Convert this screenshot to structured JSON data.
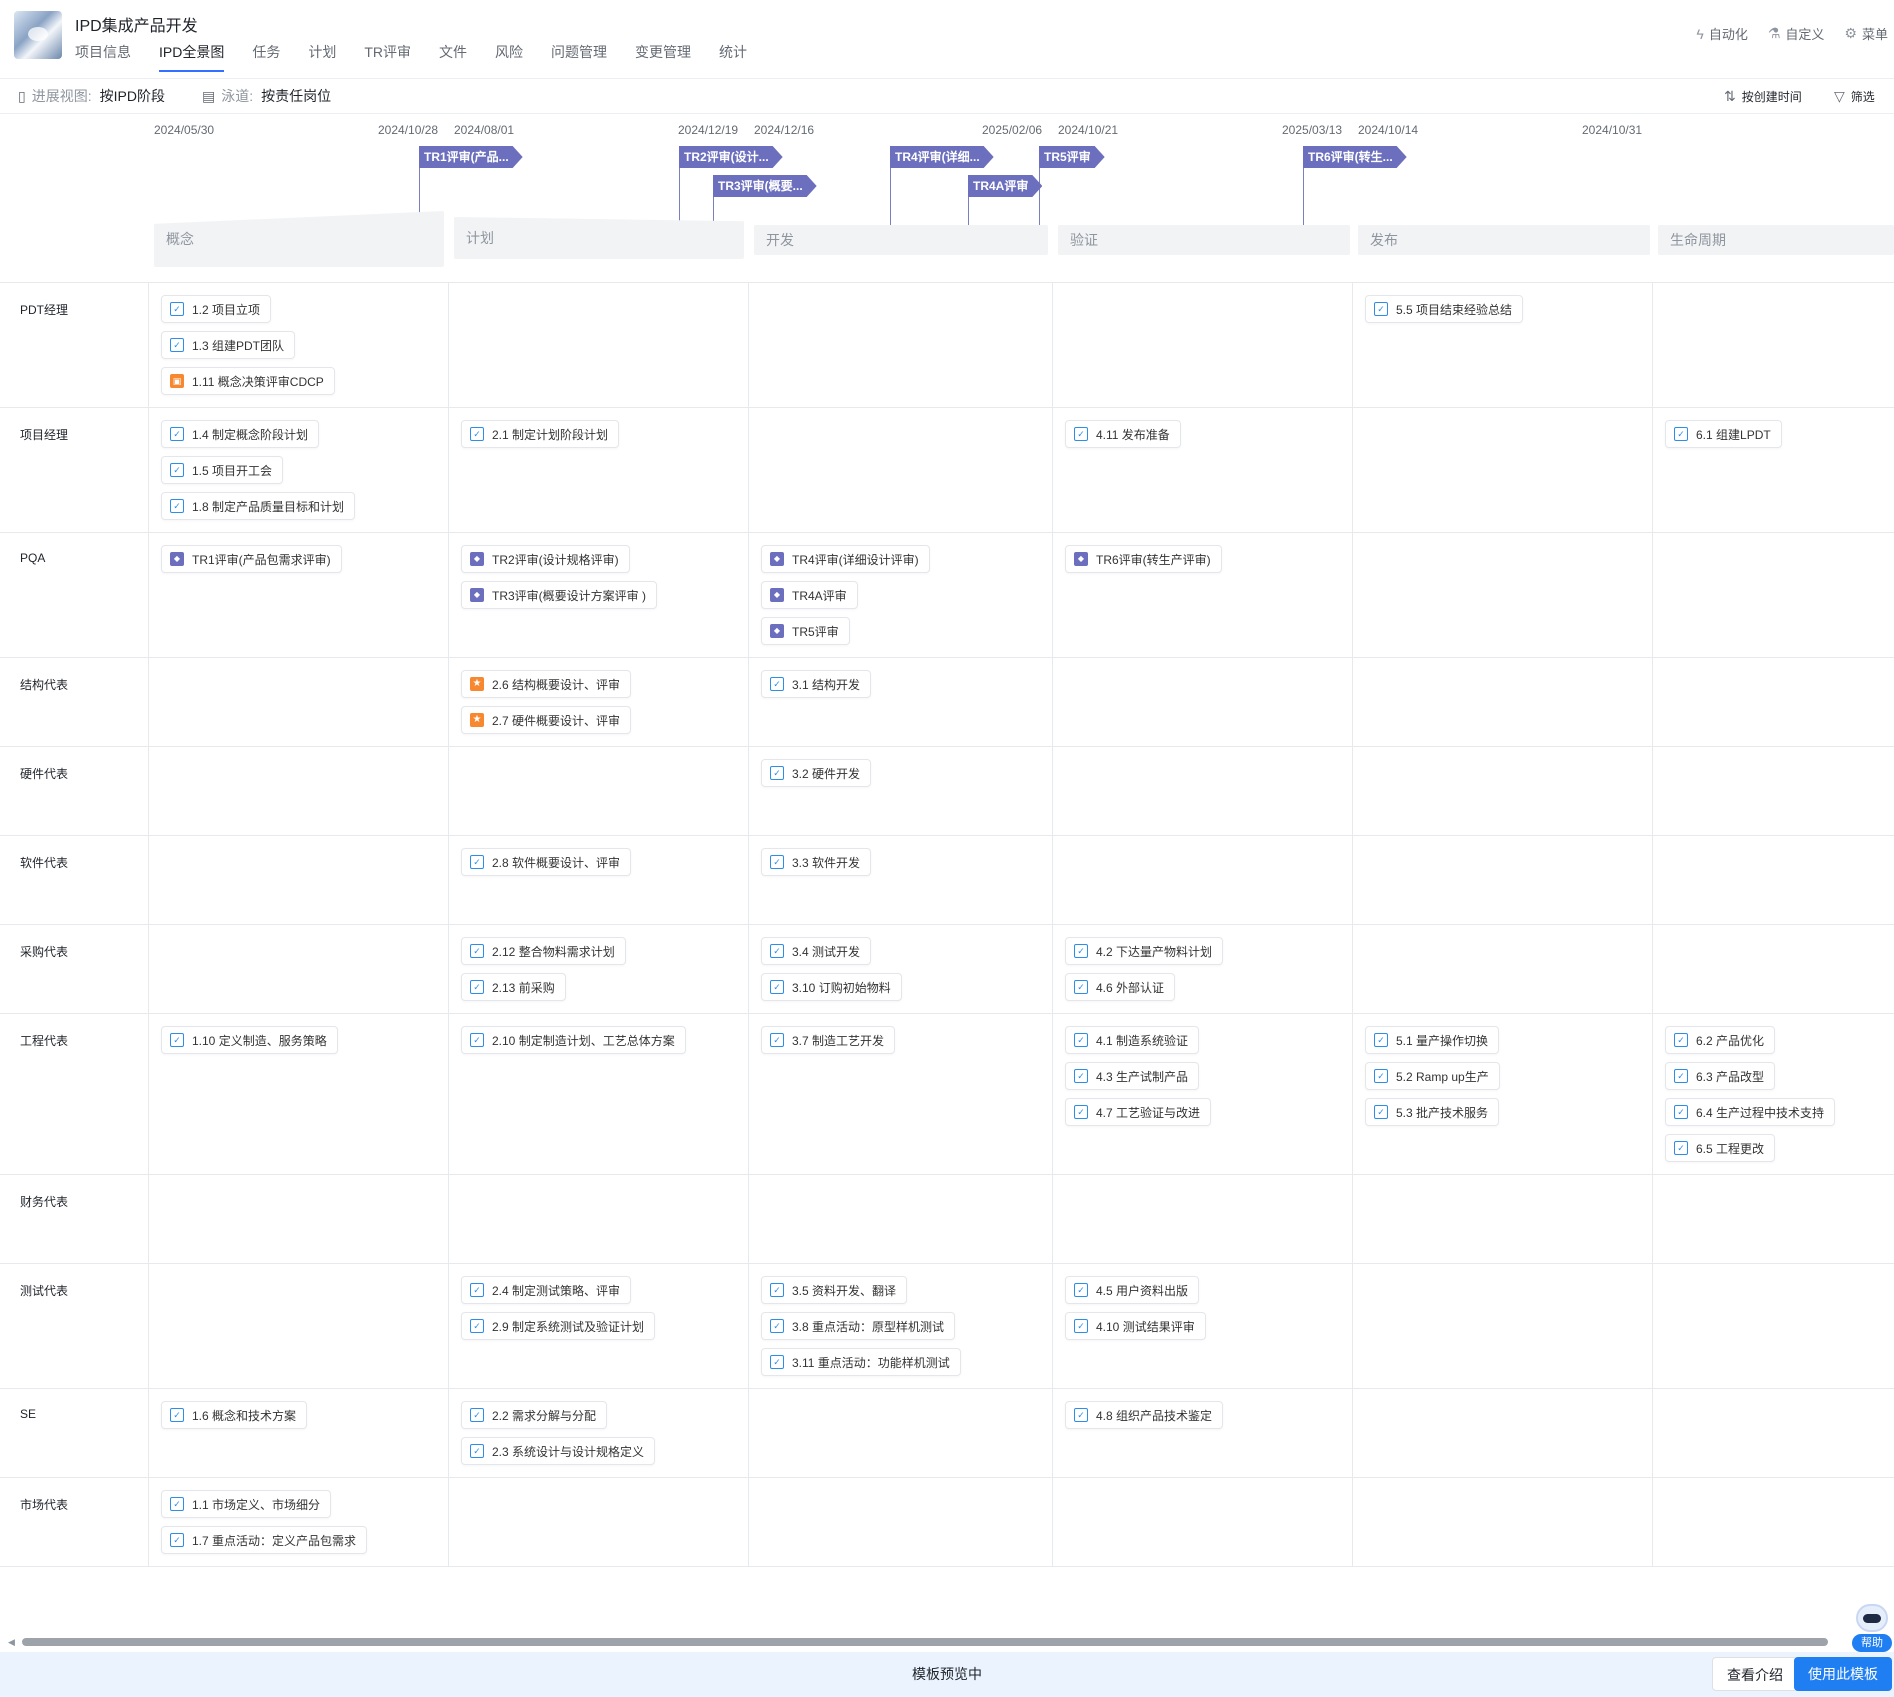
{
  "app": {
    "title": "IPD集成产品开发",
    "logo": "project-thumbnail"
  },
  "nav": {
    "tabs": [
      "项目信息",
      "IPD全景图",
      "任务",
      "计划",
      "TR评审",
      "文件",
      "风险",
      "问题管理",
      "变更管理",
      "统计"
    ],
    "active_index": 1
  },
  "header_actions": [
    {
      "label": "自动化",
      "icon": "lightning-icon"
    },
    {
      "label": "自定义",
      "icon": "flask-icon"
    },
    {
      "label": "菜单",
      "icon": "settings-sliders-icon"
    }
  ],
  "toolbar": {
    "view_label": "进展视图:",
    "view_value": "按IPD阶段",
    "lane_label": "泳道:",
    "lane_value": "按责任岗位",
    "sort_label": "按创建时间",
    "filter_label": "筛选"
  },
  "timeline": {
    "dates": [
      "2024/05/30",
      "2024/10/28",
      "2024/08/01",
      "2024/12/19",
      "2024/12/16",
      "2025/02/06",
      "2024/10/21",
      "2025/03/13",
      "2024/10/14",
      "2024/10/31"
    ],
    "milestones": [
      "TR1评审(产品...",
      "TR2评审(设计...",
      "TR3评审(概要...",
      "TR4评审(详细...",
      "TR4A评审",
      "TR5评审",
      "TR6评审(转生..."
    ],
    "phases": [
      "概念",
      "计划",
      "开发",
      "验证",
      "发布",
      "生命周期"
    ]
  },
  "lanes": [
    {
      "name": "PDT经理",
      "cells": [
        [
          {
            "t": "task",
            "label": "1.2 项目立项"
          },
          {
            "t": "task",
            "label": "1.3 组建PDT团队"
          },
          {
            "t": "decision",
            "label": "1.11 概念决策评审CDCP"
          }
        ],
        [],
        [],
        [],
        [
          {
            "t": "task",
            "label": "5.5 项目结束经验总结"
          }
        ],
        []
      ]
    },
    {
      "name": "项目经理",
      "cells": [
        [
          {
            "t": "task",
            "label": "1.4 制定概念阶段计划"
          },
          {
            "t": "task",
            "label": "1.5 项目开工会"
          },
          {
            "t": "task",
            "label": "1.8 制定产品质量目标和计划"
          }
        ],
        [
          {
            "t": "task",
            "label": "2.1 制定计划阶段计划"
          }
        ],
        [],
        [
          {
            "t": "task",
            "label": "4.11 发布准备"
          }
        ],
        [],
        [
          {
            "t": "task",
            "label": "6.1 组建LPDT"
          }
        ]
      ]
    },
    {
      "name": "PQA",
      "cells": [
        [
          {
            "t": "review",
            "label": "TR1评审(产品包需求评审)"
          }
        ],
        [
          {
            "t": "review",
            "label": "TR2评审(设计规格评审)"
          },
          {
            "t": "review",
            "label": "TR3评审(概要设计方案评审 )"
          }
        ],
        [
          {
            "t": "review",
            "label": "TR4评审(详细设计评审)"
          },
          {
            "t": "review",
            "label": "TR4A评审"
          },
          {
            "t": "review",
            "label": "TR5评审"
          }
        ],
        [
          {
            "t": "review",
            "label": "TR6评审(转生产评审)"
          }
        ],
        [],
        []
      ]
    },
    {
      "name": "结构代表",
      "cells": [
        [],
        [
          {
            "t": "milestone",
            "label": "2.6 结构概要设计、评审"
          },
          {
            "t": "milestone",
            "label": "2.7 硬件概要设计、评审"
          }
        ],
        [
          {
            "t": "task",
            "label": "3.1 结构开发"
          }
        ],
        [],
        [],
        []
      ]
    },
    {
      "name": "硬件代表",
      "cells": [
        [],
        [],
        [
          {
            "t": "task",
            "label": "3.2 硬件开发"
          }
        ],
        [],
        [],
        []
      ]
    },
    {
      "name": "软件代表",
      "cells": [
        [],
        [
          {
            "t": "task",
            "label": "2.8 软件概要设计、评审"
          }
        ],
        [
          {
            "t": "task",
            "label": "3.3 软件开发"
          }
        ],
        [],
        [],
        []
      ]
    },
    {
      "name": "采购代表",
      "cells": [
        [],
        [
          {
            "t": "task",
            "label": "2.12 整合物料需求计划"
          },
          {
            "t": "task",
            "label": "2.13 前采购"
          }
        ],
        [
          {
            "t": "task",
            "label": "3.4 测试开发"
          },
          {
            "t": "task",
            "label": "3.10 订购初始物料"
          }
        ],
        [
          {
            "t": "task",
            "label": "4.2 下达量产物料计划"
          },
          {
            "t": "task",
            "label": "4.6 外部认证"
          }
        ],
        [],
        []
      ]
    },
    {
      "name": "工程代表",
      "cells": [
        [
          {
            "t": "task",
            "label": "1.10 定义制造、服务策略"
          }
        ],
        [
          {
            "t": "task",
            "label": "2.10 制定制造计划、工艺总体方案"
          }
        ],
        [
          {
            "t": "task",
            "label": "3.7 制造工艺开发"
          }
        ],
        [
          {
            "t": "task",
            "label": "4.1 制造系统验证"
          },
          {
            "t": "task",
            "label": "4.3 生产试制产品"
          },
          {
            "t": "task",
            "label": "4.7 工艺验证与改进"
          }
        ],
        [
          {
            "t": "task",
            "label": "5.1 量产操作切换"
          },
          {
            "t": "task",
            "label": "5.2 Ramp up生产"
          },
          {
            "t": "task",
            "label": "5.3 批产技术服务"
          }
        ],
        [
          {
            "t": "task",
            "label": "6.2 产品优化"
          },
          {
            "t": "task",
            "label": "6.3 产品改型"
          },
          {
            "t": "task",
            "label": "6.4 生产过程中技术支持"
          },
          {
            "t": "task",
            "label": "6.5 工程更改"
          }
        ]
      ]
    },
    {
      "name": "财务代表",
      "cells": [
        [],
        [],
        [],
        [],
        [],
        []
      ]
    },
    {
      "name": "测试代表",
      "cells": [
        [],
        [
          {
            "t": "task",
            "label": "2.4 制定测试策略、评审"
          },
          {
            "t": "task",
            "label": "2.9 制定系统测试及验证计划"
          }
        ],
        [
          {
            "t": "task",
            "label": "3.5 资料开发、翻译"
          },
          {
            "t": "task",
            "label": "3.8 重点活动：原型样机测试"
          },
          {
            "t": "task",
            "label": "3.11 重点活动：功能样机测试"
          }
        ],
        [
          {
            "t": "task",
            "label": "4.5 用户资料出版"
          },
          {
            "t": "task",
            "label": "4.10 测试结果评审"
          }
        ],
        [],
        []
      ]
    },
    {
      "name": "SE",
      "cells": [
        [
          {
            "t": "task",
            "label": "1.6 概念和技术方案"
          }
        ],
        [
          {
            "t": "task",
            "label": "2.2 需求分解与分配"
          },
          {
            "t": "task",
            "label": "2.3 系统设计与设计规格定义"
          }
        ],
        [],
        [
          {
            "t": "task",
            "label": "4.8 组织产品技术鉴定"
          }
        ],
        [],
        []
      ]
    },
    {
      "name": "市场代表",
      "cells": [
        [
          {
            "t": "task",
            "label": "1.1 市场定义、市场细分"
          },
          {
            "t": "task",
            "label": "1.7 重点活动：定义产品包需求"
          }
        ],
        [],
        [],
        [],
        [],
        []
      ]
    }
  ],
  "bottom_bar": {
    "status": "模板预览中",
    "intro_button": "查看介绍",
    "use_button": "使用此模板"
  },
  "help": {
    "label": "帮助"
  },
  "colors": {
    "accent": "#1f7ef2",
    "milestone": "#6b6fbd",
    "task_icon": "#2e8ee6",
    "orange_icon": "#f7882f"
  }
}
